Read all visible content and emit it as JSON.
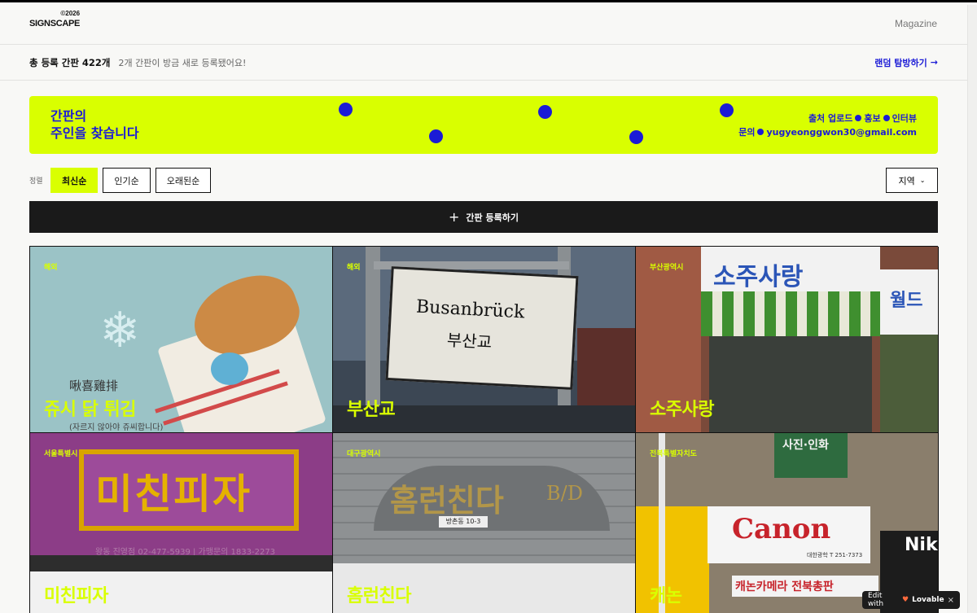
{
  "header": {
    "logo": "SIGNSCAPE",
    "logo_year": "©2026",
    "nav_magazine": "Magazine"
  },
  "stats": {
    "total": "총 등록 간판 422개",
    "recent": "2개 간판이 방금 새로 등록됐어요!",
    "random_link": "랜덤 탐방하기",
    "arrow": "→"
  },
  "banner": {
    "title_line1": "간판의",
    "title_line2": "주인을 찾습니다",
    "line1_a": "출처 업로드",
    "line1_b": "홍보",
    "line1_c": "인터뷰",
    "line2_a": "문의",
    "line2_b": "yugyeonggwon30@gmail.com"
  },
  "sort": {
    "label": "정렬",
    "options": [
      "최신순",
      "인기순",
      "오래된순"
    ],
    "region": "지역"
  },
  "register": {
    "label": "간판 등록하기",
    "plus": "+"
  },
  "cards": [
    {
      "region": "해외",
      "name": "쥬시 닭 튀김"
    },
    {
      "region": "해외",
      "name": "부산교"
    },
    {
      "region": "부산광역시",
      "name": "소주사랑"
    },
    {
      "region": "서울특별시",
      "name": "미친피자"
    },
    {
      "region": "대구광역시",
      "name": "홈런친다"
    },
    {
      "region": "전북특별자치도",
      "name": "캐논"
    }
  ],
  "card_art": {
    "c1_han": "啾喜雞排",
    "c1_sub": "(자르지 않아야 쥬씨합니다)",
    "c2_text1": "Busanbrück",
    "c2_text2": "부산교",
    "c3_sign": "소주사랑",
    "c3_side": "월드",
    "c4_sign": "미친피자",
    "c4_info": "왕동 진영점 02-477-5939 | 가맹문의 1833-2273",
    "c5_sign": "홈런친다",
    "c5_bd": "B/D",
    "c5_addr": "방촌동 10-3",
    "c6_top": "사진·인화",
    "c6_canon": "Canon",
    "c6_tel": "대한광학 T 251-7373",
    "c6_bar": "캐논카메라 전북총판",
    "c6_nik": "Nik"
  },
  "lovable": {
    "edit": "Edit with",
    "brand": "Lovable",
    "close": "×"
  },
  "colors": {
    "accent": "#d9ff00",
    "brand_blue": "#1b1bd6",
    "dark": "#1a1a1a"
  }
}
